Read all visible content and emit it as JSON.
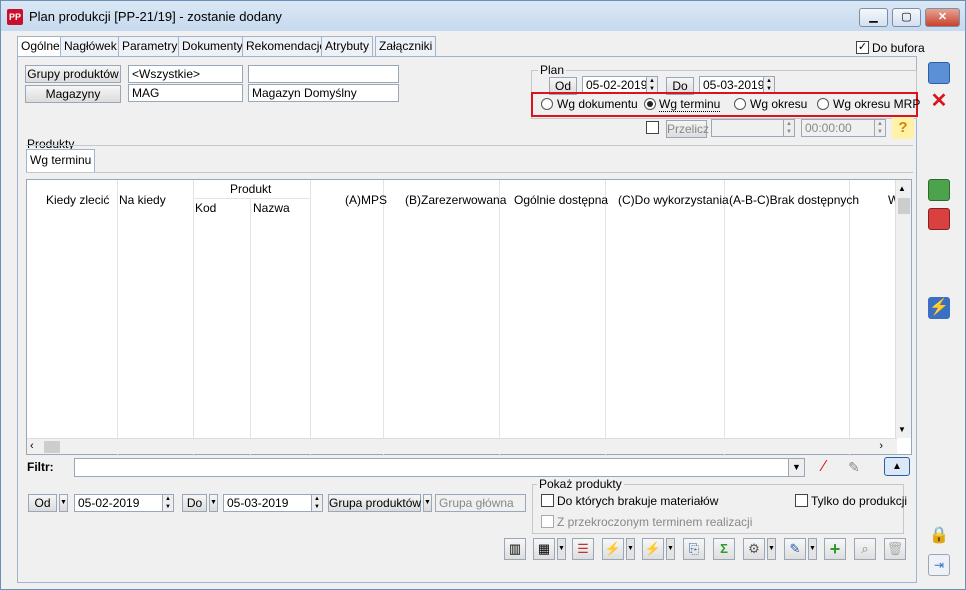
{
  "window": {
    "title": "Plan produkcji [PP-21/19] - zostanie dodany",
    "app_icon_text": "PP"
  },
  "tabs": [
    "Ogólne",
    "Nagłówek",
    "Parametry",
    "Dokumenty",
    "Rekomendacje",
    "Atrybuty",
    "Załączniki"
  ],
  "do_bufora_label": "Do bufora",
  "do_bufora_checked": true,
  "filters": {
    "grupy_label": "Grupy produktów",
    "grupy_value": "<Wszystkie>",
    "grupy_value2": "",
    "magazyny_label": "Magazyny",
    "magazyn_code": "MAG",
    "magazyn_name": "Magazyn Domyślny"
  },
  "plan": {
    "label": "Plan",
    "od_label": "Od",
    "od_value": "05-02-2019",
    "do_label": "Do",
    "do_value": "05-03-2019",
    "radios": [
      "Wg dokumentu",
      "Wg terminu",
      "Wg okresu",
      "Wg okresu MRP"
    ],
    "selected": "Wg terminu",
    "przelicz_label": "Przelicz",
    "przelicz_date": "",
    "przelicz_time": "00:00:00"
  },
  "products": {
    "label": "Produkty",
    "subtab": "Wg terminu",
    "columns": {
      "kiedy": "Kiedy zlecić",
      "na_kiedy": "Na kiedy",
      "produkt": "Produkt",
      "kod": "Kod",
      "nazwa": "Nazwa",
      "mps": "(A)MPS",
      "zarezerwowana": "(B)Zarezerwowana",
      "ogolnie": "Ogólnie dostępna",
      "do_wykorzystania": "(C)Do wykorzystania",
      "brak": "(A-B-C)Brak dostępnych",
      "w": "W"
    }
  },
  "filter_label": "Filtr:",
  "bottom": {
    "od_label": "Od",
    "od_value": "05-02-2019",
    "do_label": "Do",
    "do_value": "05-03-2019",
    "grupa_label": "Grupa produktów",
    "grupa_value": "Grupa główna",
    "pokaz_label": "Pokaż produkty",
    "brakuje_label": "Do których brakuje materiałów",
    "tylko_label": "Tylko do produkcji",
    "przekroczony_label": "Z przekroczonym terminem realizacji"
  },
  "colors": {
    "accent_red": "#d9141e",
    "title_bg": "#c6d9ee"
  }
}
